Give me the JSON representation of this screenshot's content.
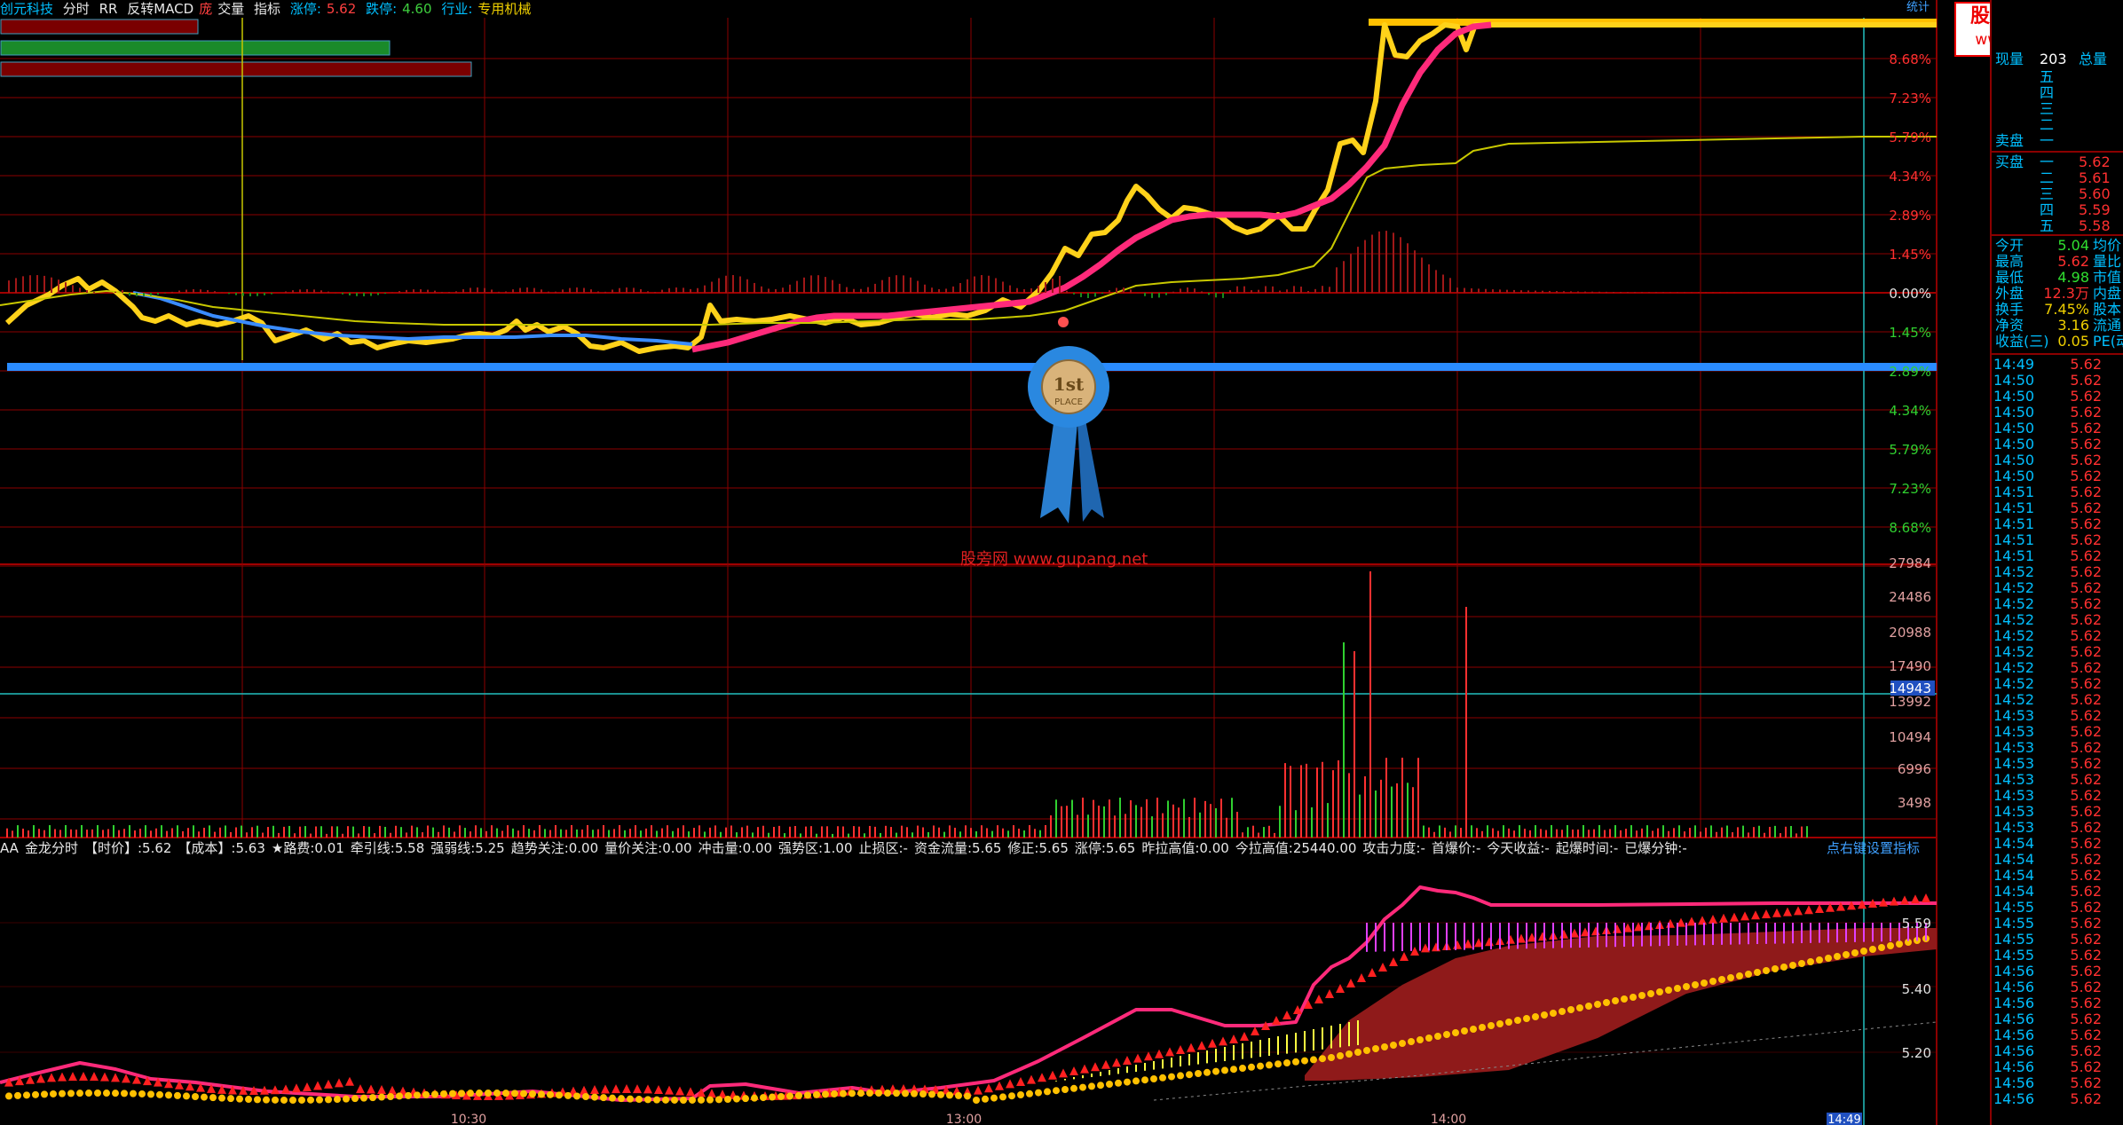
{
  "top_bar": {
    "stock_name": "创元科技",
    "items": [
      "分时",
      "RR",
      "反转MACD",
      "庞",
      "交量",
      "指标"
    ],
    "limit_up_label": "涨停:",
    "limit_up_value": "5.62",
    "limit_down_label": "跌停:",
    "limit_down_value": "4.60",
    "industry_label": "行业:",
    "industry_value": "专用机械"
  },
  "top_right_label": "统计",
  "watermark": {
    "line1": "股票公式指标网",
    "line2": "www.gupang.net"
  },
  "center_watermark": "股旁网 www.gupang.net",
  "ribbon": {
    "top": "1",
    "sup": "st",
    "bottom": "PLACE"
  },
  "price_axis_labels": [
    "8.68%",
    "7.23%",
    "5.79%",
    "4.34%",
    "2.89%",
    "1.45%",
    "0.00%",
    "1.45%",
    "2.89%",
    "4.34%",
    "5.79%",
    "7.23%",
    "8.68%"
  ],
  "volume_axis_labels": [
    "27984",
    "24486",
    "20988",
    "17490",
    "13992",
    "10494",
    "6996",
    "3498"
  ],
  "volume_cursor_value": "14943",
  "indicator_axis_labels": [
    "5.59",
    "5.40",
    "5.20"
  ],
  "time_axis_labels": [
    "10:30",
    "13:00",
    "14:00"
  ],
  "time_cursor_label": "14:49",
  "indicator_line": {
    "items": [
      "AA",
      "金龙分时",
      "【时价】:5.62",
      "【成本】:5.63",
      "★路费:0.01",
      "牵引线:5.58",
      "强弱线:5.25",
      "趋势关注:0.00",
      "量价关注:0.00",
      "冲击量:0.00",
      "强势区:1.00",
      "止损区:-",
      "资金流量:5.65",
      "修正:5.65",
      "涨停:5.65",
      "昨拉高值:0.00",
      "今拉高值:25440.00",
      "攻击力度:-",
      "首爆价:-",
      "今天收益:-",
      "起爆时间:-",
      "已爆分钟:-"
    ],
    "setting_link": "点右键设置指标"
  },
  "side_panel": {
    "rows": [
      {
        "label": "现量",
        "value": "203",
        "value_color": "white",
        "extra": "总量"
      },
      {
        "label": "",
        "value": "五",
        "value_color": "blue",
        "extra": ""
      },
      {
        "label": "",
        "value": "四",
        "value_color": "blue",
        "extra": ""
      },
      {
        "label": "",
        "value": "三",
        "value_color": "blue",
        "extra": ""
      },
      {
        "label": "",
        "value": "二",
        "value_color": "blue",
        "extra": ""
      },
      {
        "label": "卖盘",
        "value": "一",
        "value_color": "blue",
        "extra": ""
      },
      {
        "label": "买盘",
        "value": "一",
        "value_color": "blue",
        "extra": "5.62"
      },
      {
        "label": "",
        "value": "二",
        "value_color": "blue",
        "extra": "5.61"
      },
      {
        "label": "",
        "value": "三",
        "value_color": "blue",
        "extra": "5.60"
      },
      {
        "label": "",
        "value": "四",
        "value_color": "blue",
        "extra": "5.59"
      },
      {
        "label": "",
        "value": "五",
        "value_color": "blue",
        "extra": "5.58"
      }
    ],
    "stats": [
      {
        "label": "今开",
        "value": "5.04",
        "value_color": "green",
        "extra": "均价"
      },
      {
        "label": "最高",
        "value": "5.62",
        "value_color": "red",
        "extra": "量比"
      },
      {
        "label": "最低",
        "value": "4.98",
        "value_color": "green",
        "extra": "市值"
      },
      {
        "label": "外盘",
        "value": "12.3万",
        "value_color": "red",
        "extra": "内盘"
      },
      {
        "label": "换手",
        "value": "7.45%",
        "value_color": "yellow",
        "extra": "股本"
      },
      {
        "label": "净资",
        "value": "3.16",
        "value_color": "yellow",
        "extra": "流通"
      },
      {
        "label": "收益(三)",
        "value": "0.05",
        "value_color": "yellow",
        "extra": "PE(动)"
      }
    ]
  },
  "ticks": [
    {
      "time": "14:49",
      "price": "5.62"
    },
    {
      "time": "14:50",
      "price": "5.62"
    },
    {
      "time": "14:50",
      "price": "5.62"
    },
    {
      "time": "14:50",
      "price": "5.62"
    },
    {
      "time": "14:50",
      "price": "5.62"
    },
    {
      "time": "14:50",
      "price": "5.62"
    },
    {
      "time": "14:50",
      "price": "5.62"
    },
    {
      "time": "14:50",
      "price": "5.62"
    },
    {
      "time": "14:51",
      "price": "5.62"
    },
    {
      "time": "14:51",
      "price": "5.62"
    },
    {
      "time": "14:51",
      "price": "5.62"
    },
    {
      "time": "14:51",
      "price": "5.62"
    },
    {
      "time": "14:51",
      "price": "5.62"
    },
    {
      "time": "14:52",
      "price": "5.62"
    },
    {
      "time": "14:52",
      "price": "5.62"
    },
    {
      "time": "14:52",
      "price": "5.62"
    },
    {
      "time": "14:52",
      "price": "5.62"
    },
    {
      "time": "14:52",
      "price": "5.62"
    },
    {
      "time": "14:52",
      "price": "5.62"
    },
    {
      "time": "14:52",
      "price": "5.62"
    },
    {
      "time": "14:52",
      "price": "5.62"
    },
    {
      "time": "14:52",
      "price": "5.62"
    },
    {
      "time": "14:53",
      "price": "5.62"
    },
    {
      "time": "14:53",
      "price": "5.62"
    },
    {
      "time": "14:53",
      "price": "5.62"
    },
    {
      "time": "14:53",
      "price": "5.62"
    },
    {
      "time": "14:53",
      "price": "5.62"
    },
    {
      "time": "14:53",
      "price": "5.62"
    },
    {
      "time": "14:53",
      "price": "5.62"
    },
    {
      "time": "14:53",
      "price": "5.62"
    },
    {
      "time": "14:54",
      "price": "5.62"
    },
    {
      "time": "14:54",
      "price": "5.62"
    },
    {
      "time": "14:54",
      "price": "5.62"
    },
    {
      "time": "14:54",
      "price": "5.62"
    },
    {
      "time": "14:55",
      "price": "5.62"
    },
    {
      "time": "14:55",
      "price": "5.62"
    },
    {
      "time": "14:55",
      "price": "5.62"
    },
    {
      "time": "14:55",
      "price": "5.62"
    },
    {
      "time": "14:56",
      "price": "5.62"
    },
    {
      "time": "14:56",
      "price": "5.62"
    },
    {
      "time": "14:56",
      "price": "5.62"
    },
    {
      "time": "14:56",
      "price": "5.62"
    },
    {
      "time": "14:56",
      "price": "5.62"
    },
    {
      "time": "14:56",
      "price": "5.62"
    },
    {
      "time": "14:56",
      "price": "5.62"
    },
    {
      "time": "14:56",
      "price": "5.62"
    },
    {
      "time": "14:56",
      "price": "5.62"
    }
  ],
  "colors": {
    "grid": "#8b0000",
    "price_line": "#ffd21a",
    "avg_line": "#ff2a7a",
    "ma_line": "#3a8cff",
    "thin_line": "#c8c800",
    "volume_red": "#ff3030",
    "volume_green": "#30d030",
    "cursor": "#22c0c0"
  }
}
